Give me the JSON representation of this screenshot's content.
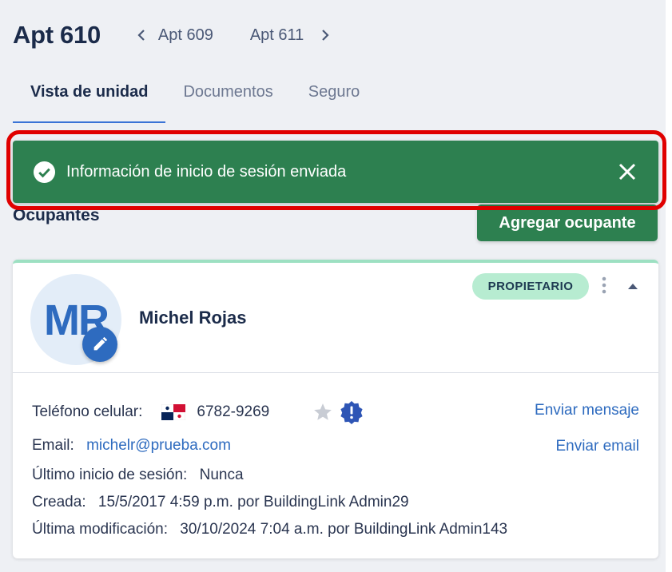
{
  "header": {
    "title": "Apt 610",
    "prev_label": "Apt 609",
    "next_label": "Apt 611"
  },
  "tabs": [
    {
      "label": "Vista de unidad",
      "active": true
    },
    {
      "label": "Documentos",
      "active": false
    },
    {
      "label": "Seguro",
      "active": false
    }
  ],
  "toast": {
    "message": "Información de inicio de sesión enviada",
    "icon": "check-circle-icon",
    "color": "#2d8050"
  },
  "section": {
    "title": "Ocupantes",
    "add_button": "Agregar ocupante"
  },
  "occupant": {
    "initials": "MR",
    "name": "Michel Rojas",
    "role_badge": "PROPIETARIO",
    "phone_label": "Teléfono celular:",
    "phone": "6782-9269",
    "phone_flag": "panama-flag-icon",
    "email_label": "Email:",
    "email": "michelr@prueba.com",
    "last_login_label": "Último inicio de sesión:",
    "last_login": "Nunca",
    "created_label": "Creada:",
    "created": "15/5/2017 4:59 p.m. por BuildingLink Admin29",
    "modified_label": "Última modificación:",
    "modified": "30/10/2024 7:04 a.m. por BuildingLink Admin143",
    "send_message": "Enviar mensaje",
    "send_email": "Enviar email"
  },
  "colors": {
    "accent": "#2e6bbf",
    "success": "#2d8050",
    "badge_bg": "#b7ecd1",
    "highlight": "#e00000"
  }
}
